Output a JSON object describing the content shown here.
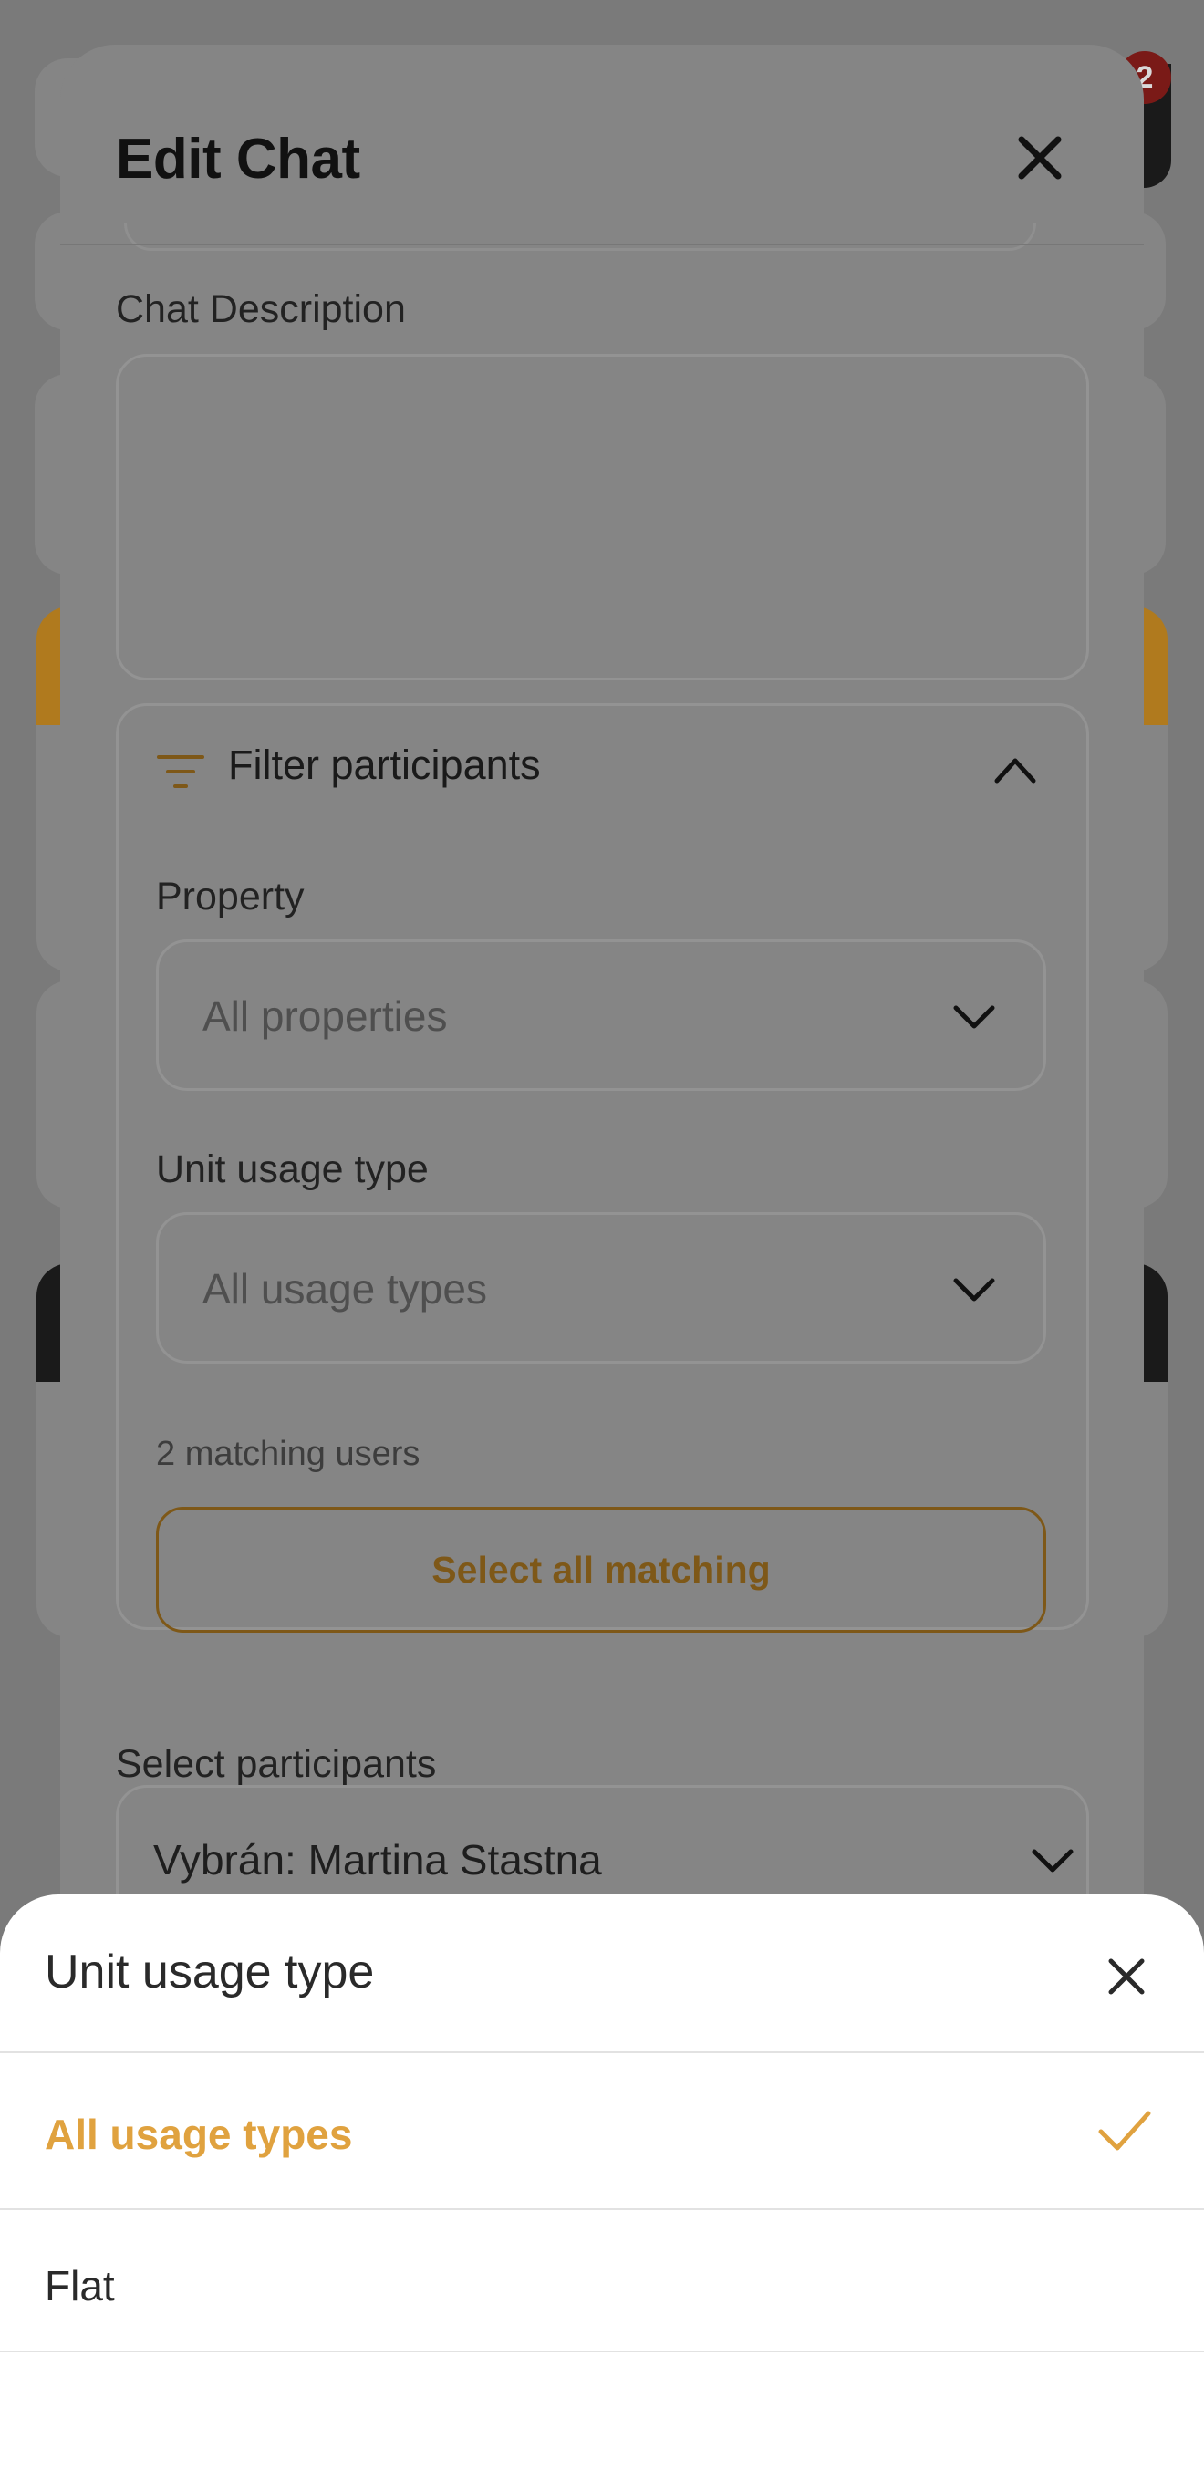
{
  "background": {
    "badge_count": "2"
  },
  "modal": {
    "title": "Edit Chat",
    "chat_description_label": "Chat Description",
    "chat_description_value": "",
    "filter": {
      "title": "Filter participants",
      "property_label": "Property",
      "property_value": "All properties",
      "unit_usage_label": "Unit usage type",
      "unit_usage_value": "All usage types",
      "matching_count": "2 matching users",
      "select_all_label": "Select all matching"
    },
    "participants_label": "Select participants",
    "participants_value": "Vybrán: Martina Stastna"
  },
  "sheet": {
    "title": "Unit usage type",
    "options": [
      {
        "label": "All usage types",
        "selected": true
      },
      {
        "label": "Flat",
        "selected": false
      }
    ]
  },
  "colors": {
    "accent": "#e0a23f",
    "overlay": "#7a7a7a"
  },
  "icons": [
    "close-icon",
    "filter-icon",
    "chevron-up-icon",
    "chevron-down-icon",
    "check-icon"
  ]
}
